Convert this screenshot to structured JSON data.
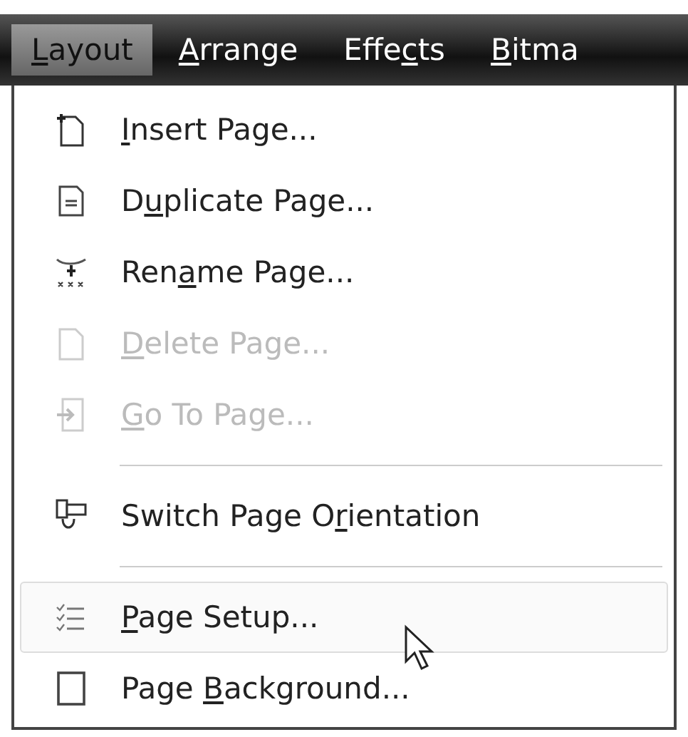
{
  "menu_bar": [
    {
      "label": "Layout",
      "selected": true
    },
    {
      "label": "Arrange",
      "selected": false
    },
    {
      "label": "Effects",
      "selected": false
    },
    {
      "label": "Bitma",
      "selected": false
    }
  ],
  "menu": {
    "items": [
      {
        "kind": "item",
        "label": "Insert Page...",
        "disabled": false,
        "selected": false
      },
      {
        "kind": "item",
        "label": "Duplicate Page...",
        "disabled": false,
        "selected": false
      },
      {
        "kind": "item",
        "label": "Rename Page...",
        "disabled": false,
        "selected": false
      },
      {
        "kind": "item",
        "label": "Delete Page...",
        "disabled": true,
        "selected": false
      },
      {
        "kind": "item",
        "label": "Go To Page...",
        "disabled": true,
        "selected": false
      },
      {
        "kind": "separator"
      },
      {
        "kind": "item",
        "label": "Switch Page Orientation",
        "disabled": false,
        "selected": false
      },
      {
        "kind": "separator"
      },
      {
        "kind": "item",
        "label": "Page Setup...",
        "disabled": false,
        "selected": true
      },
      {
        "kind": "item",
        "label": "Page Background...",
        "disabled": false,
        "selected": false
      }
    ]
  }
}
